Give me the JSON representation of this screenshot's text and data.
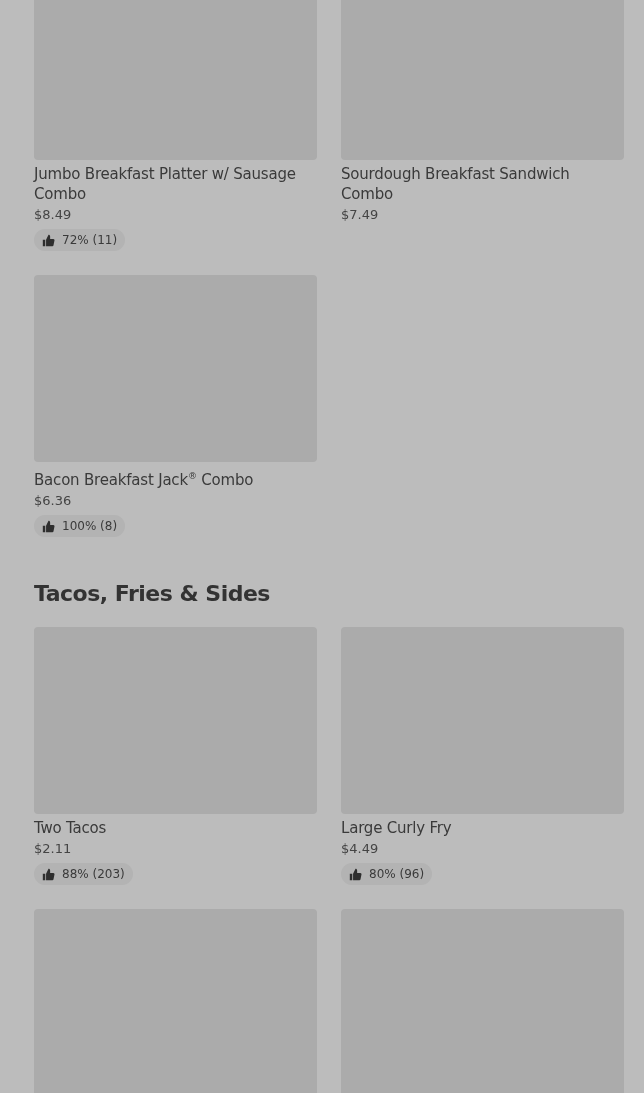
{
  "sections": [
    {
      "items": [
        {
          "kind": "full",
          "name": "Jumbo Breakfast Platter w/ Sausage Combo",
          "price": "$8.49",
          "rating": "72% (11)"
        },
        {
          "kind": "full",
          "name": "Sourdough Breakfast Sandwich Combo",
          "price": "$7.49"
        },
        {
          "kind": "full",
          "name": "Bacon Breakfast Jack$^{®}$  Combo",
          "price": "$6.36",
          "rating": "100% (8)"
        }
      ]
    },
    {
      "title": "Tacos, Fries & Sides",
      "items": [
        {
          "kind": "full",
          "name": "Two Tacos",
          "price": "$2.11",
          "rating": "88% (203)"
        },
        {
          "kind": "full",
          "name": "Large Curly Fry",
          "price": "$4.49",
          "rating": "80% (96)"
        },
        {
          "kind": "cut"
        },
        {
          "kind": "cut"
        }
      ]
    }
  ]
}
